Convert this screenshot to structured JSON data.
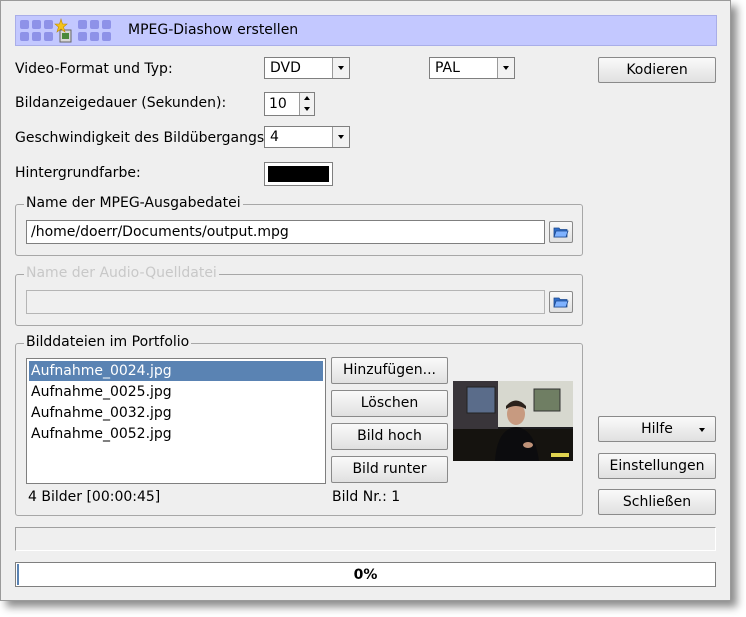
{
  "window": {
    "title": "MPEG-Diashow erstellen",
    "title_bar_color": "#c3c8ff"
  },
  "form": {
    "video_format_label": "Video-Format und Typ:",
    "video_format_value": "DVD",
    "video_norm_value": "PAL",
    "duration_label": "Bildanzeigedauer (Sekunden):",
    "duration_value": "10",
    "speed_label": "Geschwindigkeit des Bildübergangs:",
    "speed_value": "4",
    "background_label": "Hintergrundfarbe:",
    "background_color": "#000000"
  },
  "output_group": {
    "legend": "Name der MPEG-Ausgabedatei",
    "path": "/home/doerr/Documents/output.mpg",
    "browse_icon": "folder-open-icon"
  },
  "audio_group": {
    "legend": "Name der Audio-Quelldatei",
    "path": "",
    "browse_icon": "folder-open-icon"
  },
  "portfolio": {
    "legend": "Bilddateien im Portfolio",
    "files": [
      "Aufnahme_0024.jpg",
      "Aufnahme_0025.jpg",
      "Aufnahme_0032.jpg",
      "Aufnahme_0052.jpg"
    ],
    "selected_index": 0,
    "summary": "4 Bilder [00:00:45]",
    "image_number": "Bild Nr.: 1",
    "add_label": "Hinzufügen...",
    "delete_label": "Löschen",
    "move_up_label": "Bild hoch",
    "move_down_label": "Bild runter",
    "selection_color": "#5a83b3"
  },
  "buttons": {
    "encode_label": "Kodieren",
    "help_label": "Hilfe",
    "settings_label": "Einstellungen",
    "close_label": "Schließen"
  },
  "progress": {
    "text": "0%",
    "fraction": 0
  }
}
